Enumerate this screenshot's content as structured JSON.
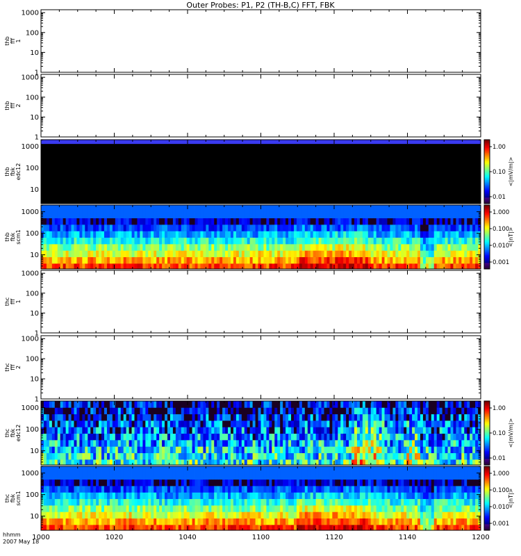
{
  "title": "Outer Probes: P1, P2 (TH-B,C) FFT, FBK",
  "time_axis": {
    "label_line1": "hhmm",
    "label_line2": "2007 May 18",
    "ticks": [
      "1000",
      "1020",
      "1040",
      "1100",
      "1120",
      "1140",
      "1200"
    ]
  },
  "colorbar_ticks": {
    "edc12": [
      "1.00",
      "0.10",
      "0.01"
    ],
    "scm1": [
      "1.000",
      "0.100",
      "0.010",
      "0.001"
    ]
  },
  "chart_data": [
    {
      "type": "heatmap",
      "panel_id": "thb_fff_1",
      "ylabel": [
        "thb",
        "fff",
        "1"
      ],
      "y_ticks": [
        "1000",
        "100",
        "10",
        "1"
      ],
      "x_range": [
        "1000",
        "1200"
      ],
      "log_scale": true,
      "data": "none"
    },
    {
      "type": "heatmap",
      "panel_id": "thb_fff_2",
      "ylabel": [
        "thb",
        "fff",
        "2"
      ],
      "y_ticks": [
        "1000",
        "100",
        "10",
        "1"
      ],
      "x_range": [
        "1000",
        "1200"
      ],
      "log_scale": true,
      "data": "none"
    },
    {
      "type": "heatmap",
      "panel_id": "thb_fbk_edc12",
      "ylabel": [
        "thb",
        "fbk",
        "edc12"
      ],
      "y_ticks": [
        "1000",
        "100",
        "10"
      ],
      "colorbar_label": "<|mV/m|>",
      "colorbar_ticks": [
        "1.00",
        "0.10",
        "0.01"
      ],
      "x_range": [
        "1000",
        "1200"
      ],
      "log_scale": true,
      "pattern": "top band blue, rest black"
    },
    {
      "type": "heatmap",
      "panel_id": "thb_fbk_scm1",
      "ylabel": [
        "thb",
        "fbk",
        "scm1"
      ],
      "y_ticks": [
        "1000",
        "100",
        "10"
      ],
      "colorbar_label": "<|nT|>",
      "colorbar_ticks": [
        "1.000",
        "0.100",
        "0.010",
        "0.001"
      ],
      "x_range": [
        "1000",
        "1200"
      ],
      "log_scale": true,
      "pattern": "low frequencies bright yellow/orange, decreasing upward"
    },
    {
      "type": "heatmap",
      "panel_id": "thc_fff_1",
      "ylabel": [
        "thc",
        "fff",
        "1"
      ],
      "y_ticks": [
        "1000",
        "100",
        "10",
        "1"
      ],
      "x_range": [
        "1000",
        "1200"
      ],
      "log_scale": true,
      "data": "none"
    },
    {
      "type": "heatmap",
      "panel_id": "thc_fff_2",
      "ylabel": [
        "thc",
        "fff",
        "2"
      ],
      "y_ticks": [
        "1000",
        "100",
        "10",
        "1"
      ],
      "x_range": [
        "1000",
        "1200"
      ],
      "log_scale": true,
      "data": "none"
    },
    {
      "type": "heatmap",
      "panel_id": "thc_fbk_edc12",
      "ylabel": [
        "thc",
        "fbk",
        "edc12"
      ],
      "y_ticks": [
        "1000",
        "100",
        "10"
      ],
      "colorbar_label": "<|mV/m|>",
      "colorbar_ticks": [
        "1.00",
        "0.10",
        "0.01"
      ],
      "x_range": [
        "1000",
        "1200"
      ],
      "log_scale": true,
      "pattern": "mixed blue/cyan, intermittent yellow bursts"
    },
    {
      "type": "heatmap",
      "panel_id": "thc_fbk_scm1",
      "ylabel": [
        "thc",
        "fbk",
        "scm1"
      ],
      "y_ticks": [
        "1000",
        "100",
        "10"
      ],
      "colorbar_label": "<|nT|>",
      "colorbar_ticks": [
        "1.000",
        "0.100",
        "0.010",
        "0.001"
      ],
      "x_range": [
        "1000",
        "1200"
      ],
      "log_scale": true,
      "pattern": "low frequencies yellow/orange, decreasing upward"
    }
  ]
}
